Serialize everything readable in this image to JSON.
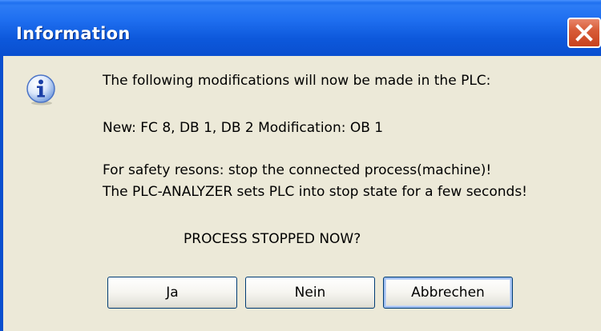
{
  "window": {
    "title": "Information",
    "close_label": "Close"
  },
  "icon": {
    "name": "info-icon",
    "glyph": "i"
  },
  "message": {
    "line1": "The following modifications will now be made in the PLC:",
    "line2": "New: FC 8, DB 1, DB 2    Modification: OB 1",
    "line3": "For safety resons: stop the connected process(machine)!",
    "line4": "The PLC-ANALYZER sets PLC into stop state for a few seconds!",
    "question": "PROCESS STOPPED NOW?"
  },
  "buttons": {
    "yes": "Ja",
    "no": "Nein",
    "cancel": "Abbrechen"
  },
  "colors": {
    "titlebar": "#0a58db",
    "client_bg": "#ece9d8",
    "close_button": "#d85c38"
  }
}
